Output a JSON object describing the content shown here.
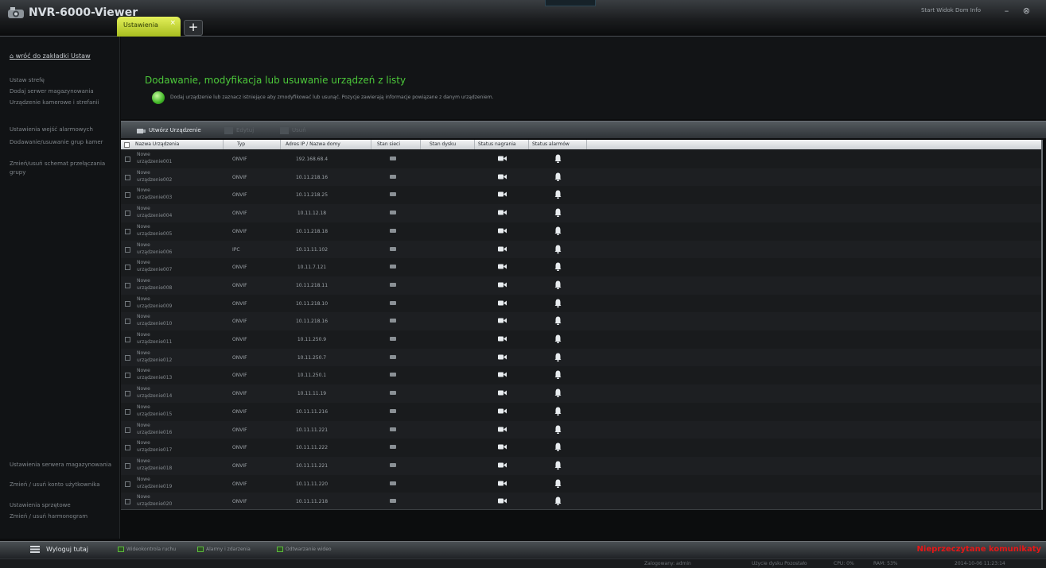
{
  "app": {
    "title": "NVR-6000-Viewer",
    "tab_label": "Ustawienia",
    "tab_close": "×",
    "add_tab": "+",
    "top_menu": "Start  Widok  Dom  Info",
    "window_controls": {
      "minimize": "–",
      "close": "⊗"
    }
  },
  "sidebar": {
    "back_link": "wróć do zakładki Ustaw",
    "items": [
      "Ustaw strefę",
      "Dodaj serwer magazynowania",
      "Urządzenie kamerowe i strefanii",
      "Ustawienia wejść alarmowych",
      "Dodawanie/usuwanie grup kamer",
      "Zmień/usuń schemat przełączania grupy"
    ],
    "bottom_items": [
      "Ustawienia serwera magazynowania",
      "Zmień / usuń konto użytkownika",
      "Ustawienia sprzętowe",
      "Zmień / usuń harmonogram"
    ]
  },
  "header": {
    "title": "Dodawanie, modyfikacja lub usuwanie urządzeń z listy",
    "description": "Dodaj urządzenie lub zaznacz istniejące aby zmodyfikować lub usunąć. Pozycje zawierają informacje powiązane z danym urządzeniem."
  },
  "toolbar": {
    "add": "Utwórz Urządzenie",
    "edit": "Edytuj",
    "delete": "Usuń"
  },
  "table": {
    "headers": [
      "Nazwa Urządzenia",
      "Typ",
      "Adres IP / Nazwa domy",
      "Stan sieci",
      "Stan dysku",
      "Status nagrania",
      "Status alarmów"
    ],
    "rows": [
      {
        "name": "Nowe\nurządzenie001",
        "type": "ONVIF",
        "ip": "192.168.68.4"
      },
      {
        "name": "Nowe\nurządzenie002",
        "type": "ONVIF",
        "ip": "10.11.218.16"
      },
      {
        "name": "Nowe\nurządzenie003",
        "type": "ONVIF",
        "ip": "10.11.218.25"
      },
      {
        "name": "Nowe\nurządzenie004",
        "type": "ONVIF",
        "ip": "10.11.12.18"
      },
      {
        "name": "Nowe\nurządzenie005",
        "type": "ONVIF",
        "ip": "10.11.218.18"
      },
      {
        "name": "Nowe\nurządzenie006",
        "type": "IPC",
        "ip": "10.11.11.102"
      },
      {
        "name": "Nowe\nurządzenie007",
        "type": "ONVIF",
        "ip": "10.11.7.121"
      },
      {
        "name": "Nowe\nurządzenie008",
        "type": "ONVIF",
        "ip": "10.11.218.11"
      },
      {
        "name": "Nowe\nurządzenie009",
        "type": "ONVIF",
        "ip": "10.11.218.10"
      },
      {
        "name": "Nowe\nurządzenie010",
        "type": "ONVIF",
        "ip": "10.11.218.16"
      },
      {
        "name": "Nowe\nurządzenie011",
        "type": "ONVIF",
        "ip": "10.11.250.9"
      },
      {
        "name": "Nowe\nurządzenie012",
        "type": "ONVIF",
        "ip": "10.11.250.7"
      },
      {
        "name": "Nowe\nurządzenie013",
        "type": "ONVIF",
        "ip": "10.11.250.1"
      },
      {
        "name": "Nowe\nurządzenie014",
        "type": "ONVIF",
        "ip": "10.11.11.19"
      },
      {
        "name": "Nowe\nurządzenie015",
        "type": "ONVIF",
        "ip": "10.11.11.216"
      },
      {
        "name": "Nowe\nurządzenie016",
        "type": "ONVIF",
        "ip": "10.11.11.221"
      },
      {
        "name": "Nowe\nurządzenie017",
        "type": "ONVIF",
        "ip": "10.11.11.222"
      },
      {
        "name": "Nowe\nurządzenie018",
        "type": "ONVIF",
        "ip": "10.11.11.221"
      },
      {
        "name": "Nowe\nurządzenie019",
        "type": "ONVIF",
        "ip": "10.11.11.220"
      },
      {
        "name": "Nowe\nurządzenie020",
        "type": "ONVIF",
        "ip": "10.11.11.218"
      }
    ]
  },
  "bottom": {
    "logout": "Wyloguj tutaj",
    "items": [
      "Wideokontrola ruchu",
      "Alarmy i zdarzenia",
      "Odtwarzanie wideo"
    ],
    "warning": "Nieprzeczytane komunikaty"
  },
  "status": [
    "Zalogowany: admin",
    "Użycie dysku  Pozostało",
    "CPU: 0%",
    "RAM: 53%",
    "2014-10-06  11:23:14"
  ],
  "colors": {
    "accent_green": "#4cc83a",
    "tab_yellow": "#c8d83a",
    "warning_red": "#e61717"
  }
}
